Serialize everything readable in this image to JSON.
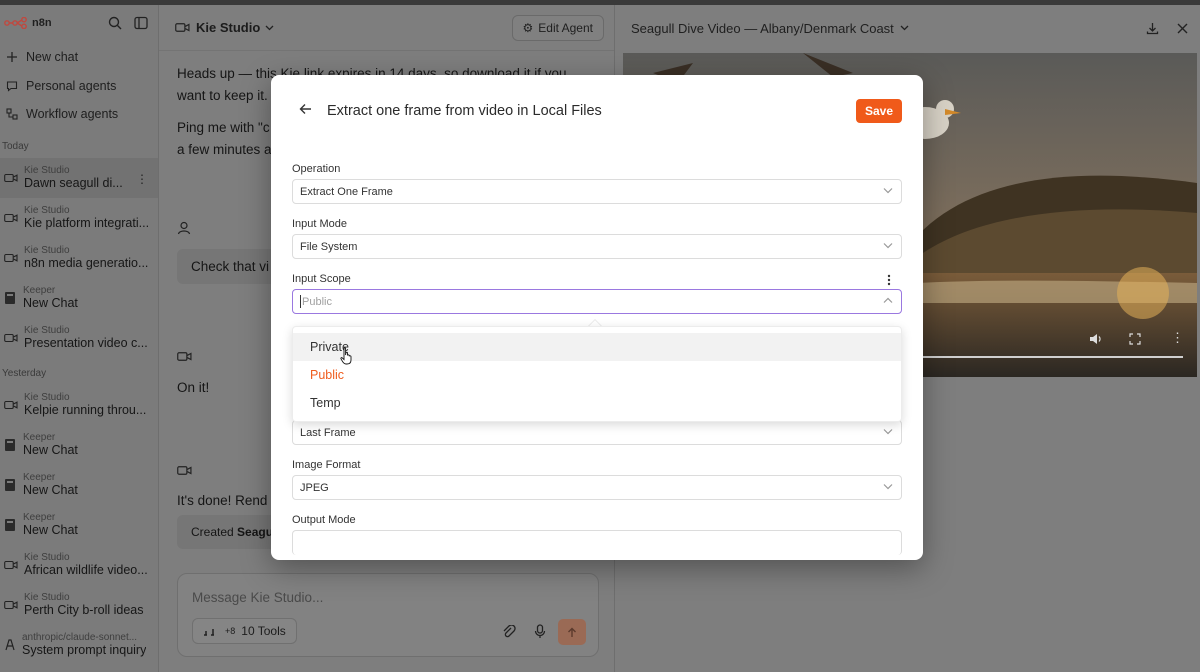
{
  "app": {
    "logo_text": "n8n"
  },
  "sidebar": {
    "nav": [
      {
        "label": "New chat",
        "icon": "plus-icon"
      },
      {
        "label": "Personal agents",
        "icon": "chat-bubble-icon"
      },
      {
        "label": "Workflow agents",
        "icon": "workflow-icon"
      }
    ],
    "sections": [
      {
        "label": "Today"
      },
      {
        "label": "Yesterday"
      }
    ],
    "today": [
      {
        "sub": "Kie Studio",
        "title": "Dawn seagull di...",
        "icon": "video-icon",
        "active": true
      },
      {
        "sub": "Kie Studio",
        "title": "Kie platform integrati...",
        "icon": "video-icon"
      },
      {
        "sub": "Kie Studio",
        "title": "n8n media generatio...",
        "icon": "video-icon"
      },
      {
        "sub": "Keeper",
        "title": "New Chat",
        "icon": "book-icon"
      },
      {
        "sub": "Kie Studio",
        "title": "Presentation video c...",
        "icon": "video-icon"
      }
    ],
    "yesterday": [
      {
        "sub": "Kie Studio",
        "title": "Kelpie running throu...",
        "icon": "video-icon"
      },
      {
        "sub": "Keeper",
        "title": "New Chat",
        "icon": "book-icon"
      },
      {
        "sub": "Keeper",
        "title": "New Chat",
        "icon": "book-icon"
      },
      {
        "sub": "Keeper",
        "title": "New Chat",
        "icon": "book-icon"
      },
      {
        "sub": "Kie Studio",
        "title": "African wildlife video...",
        "icon": "video-icon"
      },
      {
        "sub": "Kie Studio",
        "title": "Perth City b-roll ideas",
        "icon": "video-icon"
      },
      {
        "sub": "anthropic/claude-sonnet...",
        "title": "System prompt inquiry",
        "icon": "anthropic-icon"
      }
    ]
  },
  "chat": {
    "agent_name": "Kie Studio",
    "edit_label": "Edit Agent",
    "messages": {
      "m1_line1": "Heads up — this Kie link expires in 14 days, so download it if you",
      "m1_line2": "want to keep it.",
      "m2_line1": "Ping me with \"c",
      "m2_line2": "a few minutes a",
      "user_msg": "Check that vi",
      "m3": "On it!",
      "m4": "It's done! Rend",
      "created_prefix": "Created ",
      "created_bold": "Seagul"
    },
    "composer_placeholder": "Message Kie Studio...",
    "tools_count_badge": "+8",
    "tools_label": "10 Tools"
  },
  "preview": {
    "title": "Seagull Dive Video — Albany/Denmark Coast"
  },
  "modal": {
    "title": "Extract one frame from video in Local Files",
    "save_label": "Save",
    "fields": {
      "operation_label": "Operation",
      "operation_value": "Extract One Frame",
      "input_mode_label": "Input Mode",
      "input_mode_value": "File System",
      "input_scope_label": "Input Scope",
      "input_scope_placeholder": "Public",
      "frame_value": "Last Frame",
      "image_format_label": "Image Format",
      "image_format_value": "JPEG",
      "output_mode_label": "Output Mode"
    },
    "dropdown_options": [
      {
        "label": "Private",
        "state": "hover"
      },
      {
        "label": "Public",
        "state": "selected"
      },
      {
        "label": "Temp",
        "state": "normal"
      }
    ]
  },
  "colors": {
    "accent": "#f05a1a",
    "focus_border": "#9a78e0"
  }
}
